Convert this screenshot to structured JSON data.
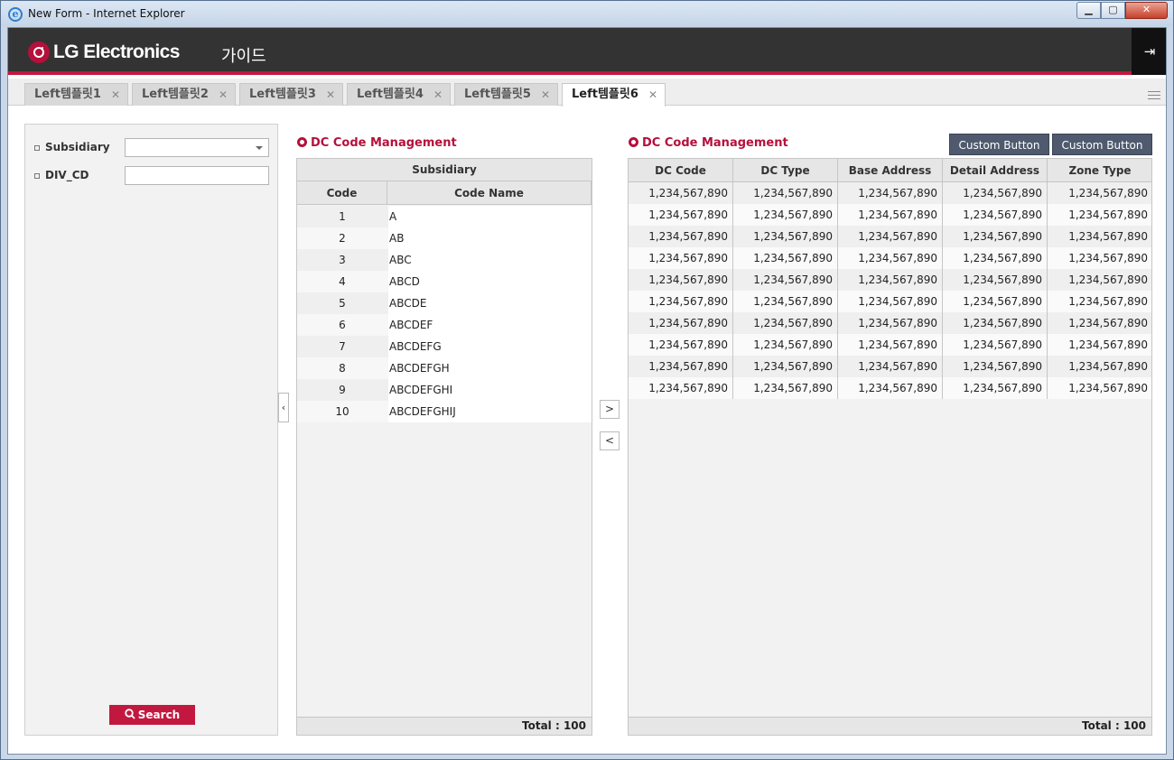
{
  "window": {
    "title": "New Form - Internet Explorer",
    "minimize": "▁",
    "maximize": "▢",
    "close": "✕"
  },
  "header": {
    "logo": "LG Electronics",
    "title": "가이드",
    "logout_icon": "⇥"
  },
  "tabs": [
    {
      "label": "Left템플릿1",
      "close": "✕"
    },
    {
      "label": "Left템플릿2",
      "close": "✕"
    },
    {
      "label": "Left템플릿3",
      "close": "✕"
    },
    {
      "label": "Left템플릿4",
      "close": "✕"
    },
    {
      "label": "Left템플릿5",
      "close": "✕"
    },
    {
      "label": "Left템플릿6",
      "close": "✕"
    }
  ],
  "search": {
    "subsidiary_label": "Subsidiary",
    "div_label": "DIV_CD",
    "subsidiary_value": "",
    "div_value": "",
    "button": "Search"
  },
  "collapse_icon": "‹",
  "table1": {
    "title": "DC Code Management",
    "group_header": "Subsidiary",
    "columns": [
      "Code",
      "Code Name"
    ],
    "rows": [
      [
        "1",
        "A"
      ],
      [
        "2",
        "AB"
      ],
      [
        "3",
        "ABC"
      ],
      [
        "4",
        "ABCD"
      ],
      [
        "5",
        "ABCDE"
      ],
      [
        "6",
        "ABCDEF"
      ],
      [
        "7",
        "ABCDEFG"
      ],
      [
        "8",
        "ABCDEFGH"
      ],
      [
        "9",
        "ABCDEFGHI"
      ],
      [
        "10",
        "ABCDEFGHIJ"
      ]
    ],
    "total": "Total : 100"
  },
  "move": {
    "right": ">",
    "left": "<"
  },
  "table2": {
    "title": "DC Code Management",
    "buttons": [
      "Custom Button",
      "Custom Button"
    ],
    "columns": [
      "DC Code",
      "DC Type",
      "Base Address",
      "Detail Address",
      "Zone Type"
    ],
    "rows": [
      [
        "1,234,567,890",
        "1,234,567,890",
        "1,234,567,890",
        "1,234,567,890",
        "1,234,567,890"
      ],
      [
        "1,234,567,890",
        "1,234,567,890",
        "1,234,567,890",
        "1,234,567,890",
        "1,234,567,890"
      ],
      [
        "1,234,567,890",
        "1,234,567,890",
        "1,234,567,890",
        "1,234,567,890",
        "1,234,567,890"
      ],
      [
        "1,234,567,890",
        "1,234,567,890",
        "1,234,567,890",
        "1,234,567,890",
        "1,234,567,890"
      ],
      [
        "1,234,567,890",
        "1,234,567,890",
        "1,234,567,890",
        "1,234,567,890",
        "1,234,567,890"
      ],
      [
        "1,234,567,890",
        "1,234,567,890",
        "1,234,567,890",
        "1,234,567,890",
        "1,234,567,890"
      ],
      [
        "1,234,567,890",
        "1,234,567,890",
        "1,234,567,890",
        "1,234,567,890",
        "1,234,567,890"
      ],
      [
        "1,234,567,890",
        "1,234,567,890",
        "1,234,567,890",
        "1,234,567,890",
        "1,234,567,890"
      ],
      [
        "1,234,567,890",
        "1,234,567,890",
        "1,234,567,890",
        "1,234,567,890",
        "1,234,567,890"
      ],
      [
        "1,234,567,890",
        "1,234,567,890",
        "1,234,567,890",
        "1,234,567,890",
        "1,234,567,890"
      ]
    ],
    "total": "Total : 100"
  }
}
